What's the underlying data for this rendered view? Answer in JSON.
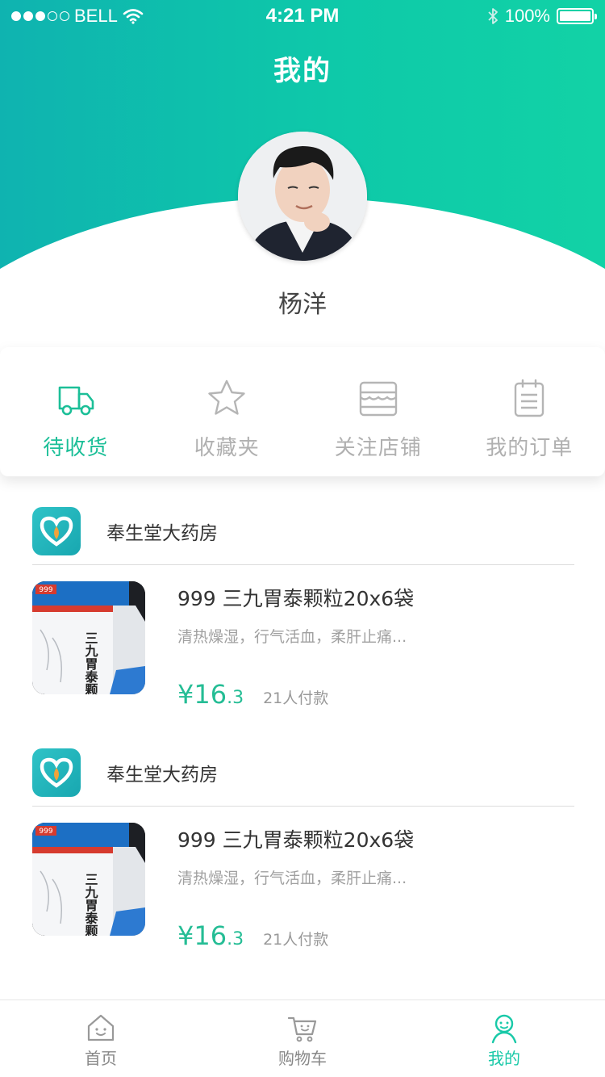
{
  "status_bar": {
    "carrier": "BELL",
    "time": "4:21 PM",
    "battery": "100%"
  },
  "header": {
    "title": "我的"
  },
  "profile": {
    "name": "杨洋"
  },
  "quick_actions": [
    {
      "label": "待收货",
      "icon": "truck-icon",
      "active": true
    },
    {
      "label": "收藏夹",
      "icon": "star-icon",
      "active": false
    },
    {
      "label": "关注店铺",
      "icon": "store-icon",
      "active": false
    },
    {
      "label": "我的订单",
      "icon": "clipboard-icon",
      "active": false
    }
  ],
  "stores": [
    {
      "name": "奉生堂大药房",
      "product": {
        "title": "999 三九胃泰颗粒20x6袋",
        "desc": "清热燥湿，行气活血，柔肝止痛...",
        "price_main": "¥16",
        "price_decimal": ".3",
        "sold": "21人付款",
        "box_text": "三九胃泰颗粒",
        "brand": "999"
      }
    },
    {
      "name": "奉生堂大药房",
      "product": {
        "title": "999 三九胃泰颗粒20x6袋",
        "desc": "清热燥湿，行气活血，柔肝止痛...",
        "price_main": "¥16",
        "price_decimal": ".3",
        "sold": "21人付款",
        "box_text": "三九胃泰颗粒",
        "brand": "999"
      }
    }
  ],
  "tabbar": [
    {
      "label": "首页",
      "icon": "home-icon",
      "active": false
    },
    {
      "label": "购物车",
      "icon": "cart-icon",
      "active": false
    },
    {
      "label": "我的",
      "icon": "person-icon",
      "active": true
    }
  ],
  "colors": {
    "accent": "#1cbf98",
    "header_start": "#0fb3b0",
    "header_end": "#12d2a6",
    "inactive": "#b0b0b0"
  }
}
